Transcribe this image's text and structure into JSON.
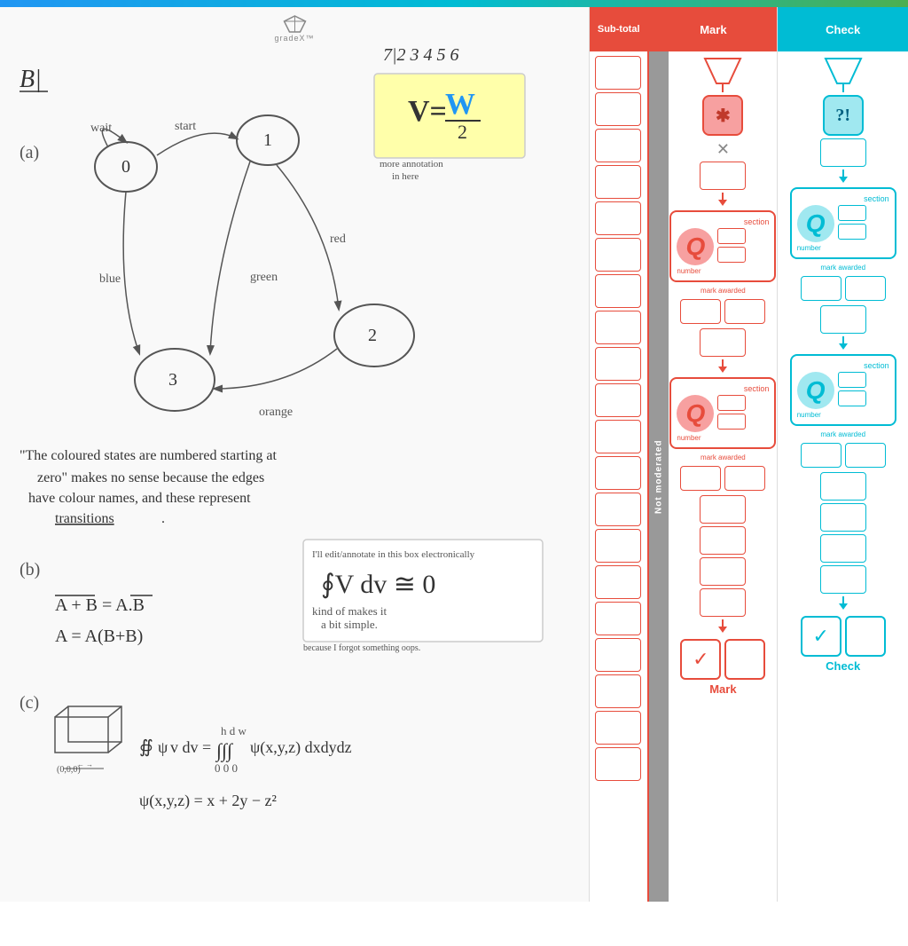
{
  "app": {
    "name": "gradeX",
    "top_bar_colors": [
      "#2196F3",
      "#00BCD4",
      "#4CAF50"
    ]
  },
  "header": {
    "student_number": "712345 6",
    "problem_label": "B|"
  },
  "columns": {
    "subtotal": {
      "label": "Sub-total"
    },
    "mark": {
      "label": "Mark"
    },
    "not_moderated": {
      "label": "Not moderated"
    },
    "check": {
      "label": "Check"
    }
  },
  "section_blocks": [
    {
      "type": "mark",
      "section_label": "section",
      "q_letter": "Q",
      "number_label": "number",
      "mark_awarded_label": "mark awarded"
    },
    {
      "type": "mark",
      "section_label": "section",
      "q_letter": "Q",
      "number_label": "number",
      "mark_awarded_label": "mark awarded"
    },
    {
      "type": "check",
      "section_label": "section",
      "q_letter": "Q",
      "number_label": "number",
      "mark_awarded_label": "mark awarded"
    },
    {
      "type": "check",
      "section_label": "section",
      "q_letter": "Q",
      "number_label": "number",
      "mark_awarded_label": "mark awarded"
    }
  ],
  "bottom_actions": {
    "mark_label": "Mark",
    "check_label": "Check"
  },
  "whiteboard": {
    "annotation": "B|",
    "student_id": "712345 6",
    "diagram_note": "state diagram with nodes 0,1,2,3",
    "transitions": [
      "wait",
      "start",
      "red",
      "blue",
      "orange",
      "green"
    ],
    "annotation_text1": "\"The coloured states are numbered starting at zero\" makes no sense because the edges have colour names, and these represent transitions.",
    "annotation_text2": "I'll edit/annotate in this box electronically",
    "formula1": "V = W/2",
    "formula2": "more annotation in here",
    "part_b": "A + B = A.B",
    "part_b2": "A = A(B+B)",
    "formula3": "∮V dv ≅ 0",
    "formula4": "kind of makes it a bit simple.",
    "formula5": "because I forgot something oops.",
    "part_c_formula": "∯ψv dv = ∫∫∫ψ(x,y,z) dxdydz",
    "part_c_formula2": "ψ(x,y,z) = x + 2y - z²"
  }
}
